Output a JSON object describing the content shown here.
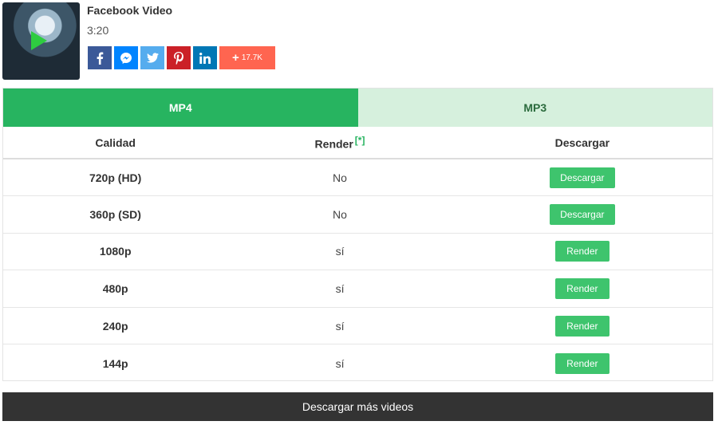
{
  "video": {
    "title": "Facebook Video",
    "duration": "3:20"
  },
  "share": {
    "buttons": [
      {
        "icon": "facebook-icon",
        "glyph": "f"
      },
      {
        "icon": "messenger-icon",
        "glyph": "m"
      },
      {
        "icon": "twitter-icon",
        "glyph": "t"
      },
      {
        "icon": "pinterest-icon",
        "glyph": "p"
      },
      {
        "icon": "linkedin-icon",
        "glyph": "in"
      }
    ],
    "more_count": "17.7K",
    "more_plus": "+"
  },
  "tabs": {
    "mp4": "MP4",
    "mp3": "MP3",
    "active": "MP4"
  },
  "table": {
    "headers": {
      "quality": "Calidad",
      "render": "Render",
      "render_note": "[*]",
      "download": "Descargar"
    },
    "rows": [
      {
        "quality": "720p (HD)",
        "render": "No",
        "action": "Descargar"
      },
      {
        "quality": "360p (SD)",
        "render": "No",
        "action": "Descargar"
      },
      {
        "quality": "1080p",
        "render": "sí",
        "action": "Render"
      },
      {
        "quality": "480p",
        "render": "sí",
        "action": "Render"
      },
      {
        "quality": "240p",
        "render": "sí",
        "action": "Render"
      },
      {
        "quality": "144p",
        "render": "sí",
        "action": "Render"
      }
    ]
  },
  "footer": {
    "more_videos": "Descargar más videos"
  },
  "colors": {
    "accent": "#27b460",
    "button": "#3ec46d",
    "tab_inactive": "#d6f0dd",
    "footer_bg": "#333333"
  }
}
